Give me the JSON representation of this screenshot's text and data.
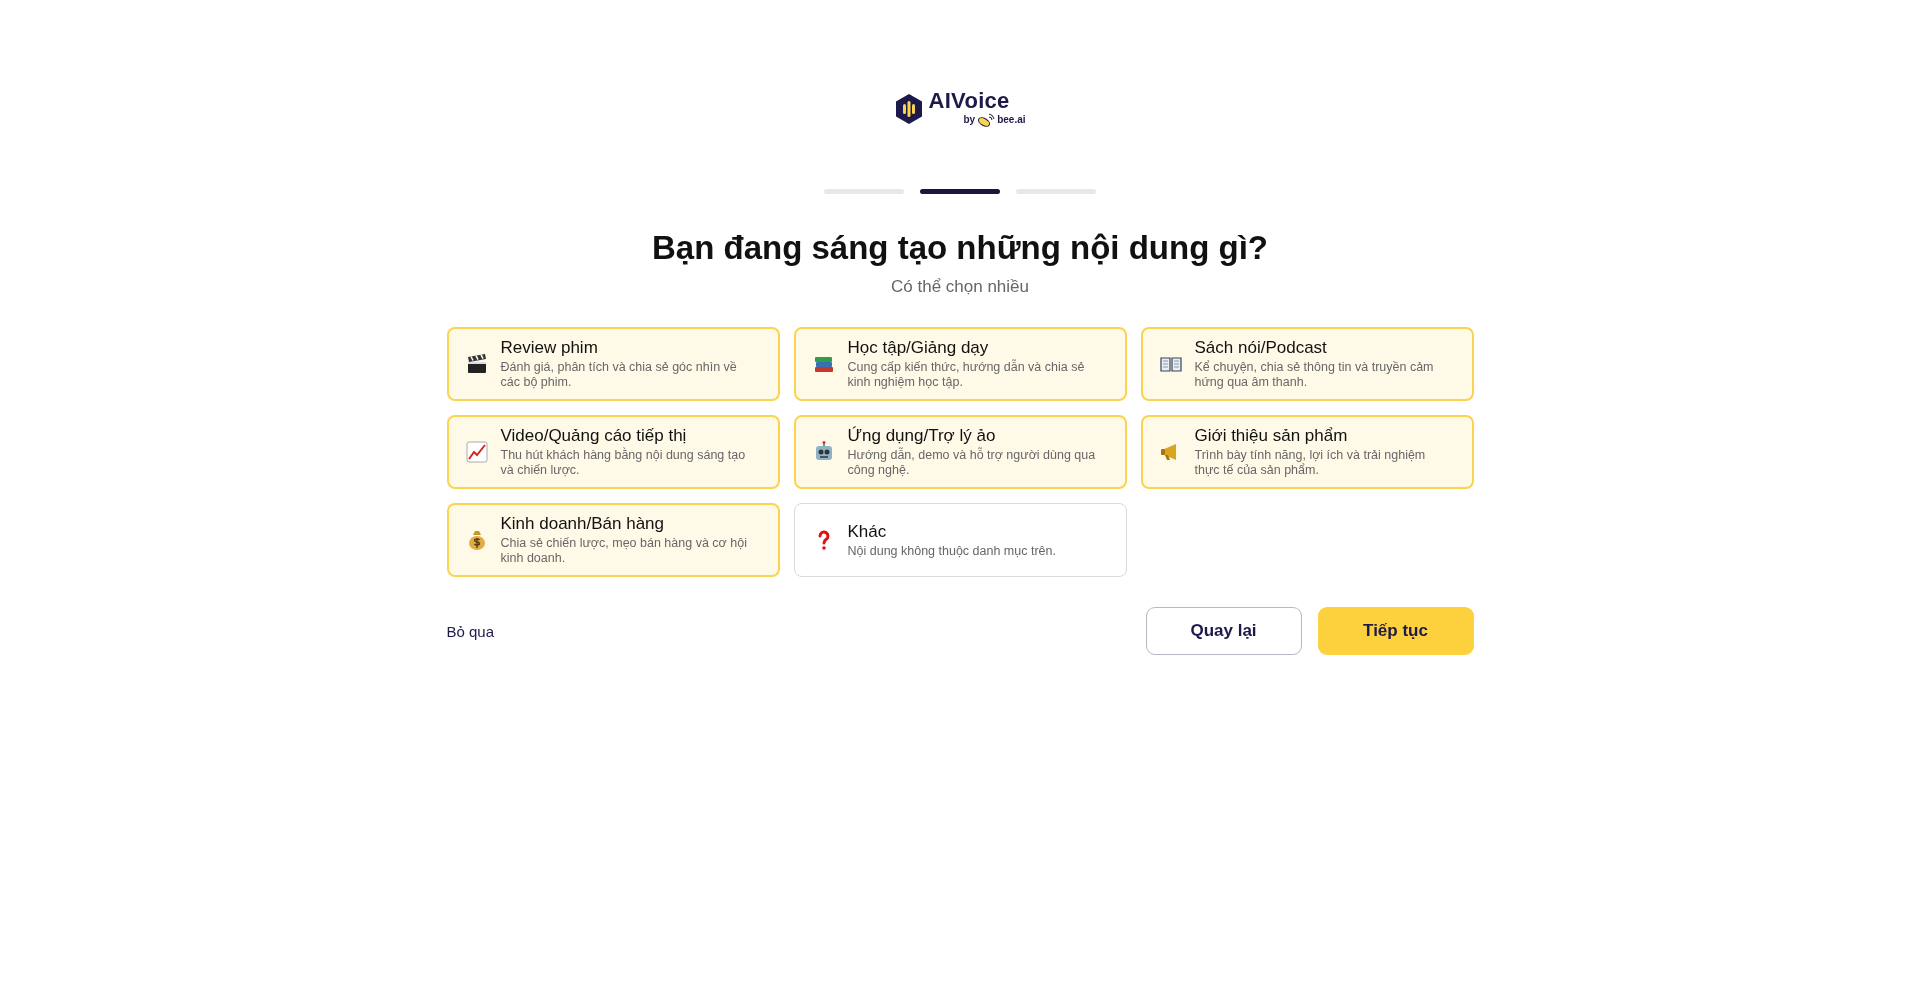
{
  "logo": {
    "name": "AIVoice",
    "by": "by",
    "brand": "bee.ai"
  },
  "progress": [
    {
      "selected": false
    },
    {
      "selected": true
    },
    {
      "selected": false
    }
  ],
  "title": "Bạn đang sáng tạo những nội dung gì?",
  "subtitle": "Có thể chọn nhiều",
  "options": [
    {
      "title": "Review phim",
      "description": "Đánh giá, phân tích và chia sẻ góc nhìn về các bộ phim.",
      "selected": true
    },
    {
      "title": "Học tập/Giảng dạy",
      "description": "Cung cấp kiến thức, hướng dẫn và chia sẻ kinh nghiệm học tập.",
      "selected": true
    },
    {
      "title": "Sách nói/Podcast",
      "description": "Kể chuyện, chia sẻ thông tin và truyền cảm hứng qua âm thanh.",
      "selected": true
    },
    {
      "title": "Video/Quảng cáo tiếp thị",
      "description": "Thu hút khách hàng bằng nội dung sáng tạo và chiến lược.",
      "selected": true
    },
    {
      "title": "Ứng dụng/Trợ lý ảo",
      "description": "Hướng dẫn, demo và hỗ trợ người dùng qua công nghệ.",
      "selected": true
    },
    {
      "title": "Giới thiệu sản phẩm",
      "description": "Trình bày tính năng, lợi ích và trải nghiệm thực tế của sản phẩm.",
      "selected": true
    },
    {
      "title": "Kinh doanh/Bán hàng",
      "description": "Chia sẻ chiến lược, mẹo bán hàng và cơ hội kinh doanh.",
      "selected": true
    },
    {
      "title": "Khác",
      "description": "Nội dung không thuộc danh mục trên.",
      "selected": false
    }
  ],
  "skip": "Bỏ qua",
  "buttons": {
    "back": "Quay lại",
    "next": "Tiếp tục"
  }
}
